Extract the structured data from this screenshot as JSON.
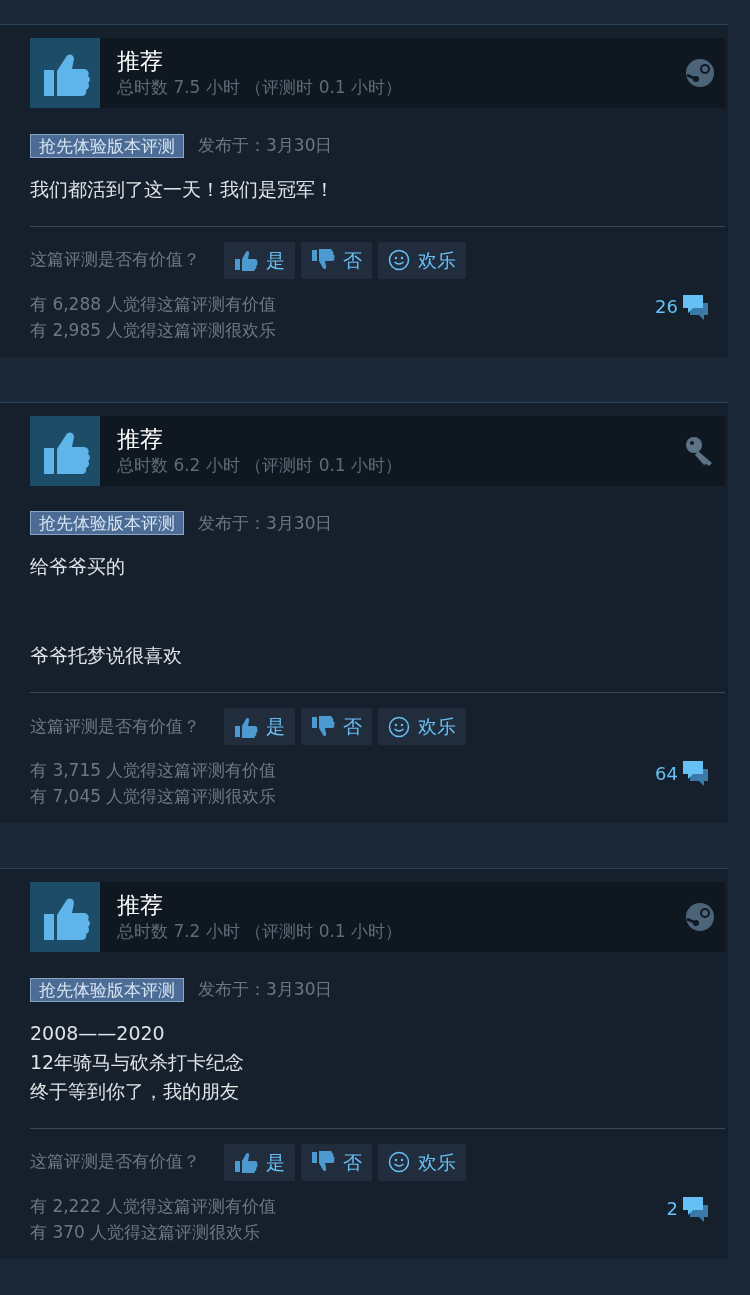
{
  "reviews": [
    {
      "verdict": "推荐",
      "hours": "总时数 7.5 小时 （评测时 0.1 小时）",
      "source_icon": {
        "kind": "steam"
      },
      "tag": "抢先体验版本评测",
      "posted": "发布于：3月30日",
      "paragraphs": [
        [
          "我们都活到了这一天！我们是冠军！"
        ]
      ],
      "helpful_prompt": "这篇评测是否有价值？",
      "buttons": [
        {
          "kind": "yes",
          "label": "是"
        },
        {
          "kind": "no",
          "label": "否"
        },
        {
          "kind": "funny",
          "label": "欢乐"
        }
      ],
      "stats": [
        "有 6,288 人觉得这篇评测有价值",
        "有 2,985 人觉得这篇评测很欢乐"
      ],
      "comments": "26"
    },
    {
      "verdict": "推荐",
      "hours": "总时数 6.2 小时 （评测时 0.1 小时）",
      "source_icon": {
        "kind": "key"
      },
      "tag": "抢先体验版本评测",
      "posted": "发布于：3月30日",
      "paragraphs": [
        [
          "给爷爷买的"
        ],
        [
          "爷爷托梦说很喜欢"
        ]
      ],
      "helpful_prompt": "这篇评测是否有价值？",
      "buttons": [
        {
          "kind": "yes",
          "label": "是"
        },
        {
          "kind": "no",
          "label": "否"
        },
        {
          "kind": "funny",
          "label": "欢乐"
        }
      ],
      "stats": [
        "有 3,715 人觉得这篇评测有价值",
        "有 7,045 人觉得这篇评测很欢乐"
      ],
      "comments": "64"
    },
    {
      "verdict": "推荐",
      "hours": "总时数 7.2 小时 （评测时 0.1 小时）",
      "source_icon": {
        "kind": "steam"
      },
      "tag": "抢先体验版本评测",
      "posted": "发布于：3月30日",
      "paragraphs": [
        [
          "2008——2020",
          "12年骑马与砍杀打卡纪念",
          "终于等到你了，我的朋友"
        ]
      ],
      "helpful_prompt": "这篇评测是否有价值？",
      "buttons": [
        {
          "kind": "yes",
          "label": "是"
        },
        {
          "kind": "no",
          "label": "否"
        },
        {
          "kind": "funny",
          "label": "欢乐"
        }
      ],
      "stats": [
        "有 2,222 人觉得这篇评测有价值",
        "有 370 人觉得这篇评测很欢乐"
      ],
      "comments": "2"
    }
  ]
}
